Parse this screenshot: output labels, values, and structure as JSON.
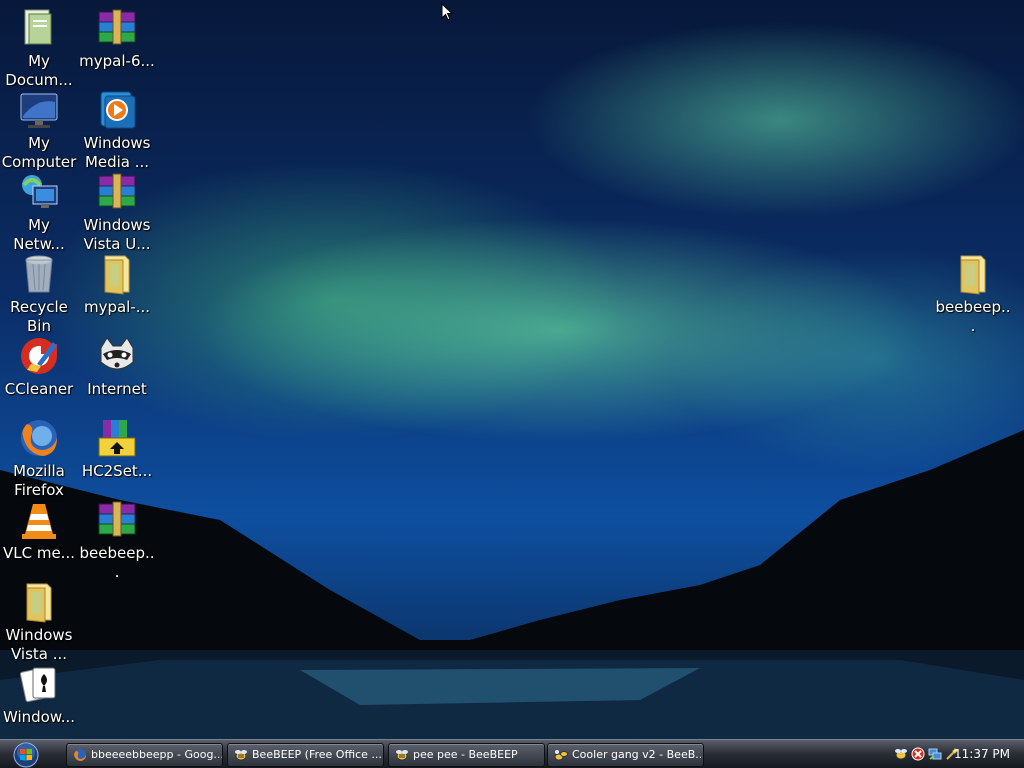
{
  "desktop": {
    "icons_left": [
      {
        "label": "My Docum...",
        "icon": "my-documents-icon"
      },
      {
        "label": "My Computer",
        "icon": "my-computer-icon"
      },
      {
        "label": "My Netw...",
        "icon": "my-network-icon"
      },
      {
        "label": "Recycle Bin",
        "icon": "recycle-bin-icon"
      },
      {
        "label": "CCleaner",
        "icon": "ccleaner-icon"
      },
      {
        "label": "Mozilla Firefox",
        "icon": "firefox-icon"
      },
      {
        "label": "VLC me...",
        "icon": "vlc-icon"
      },
      {
        "label": "Windows Vista ...",
        "icon": "folder-icon"
      },
      {
        "label": "Window...",
        "icon": "solitaire-icon"
      }
    ],
    "icons_col2": [
      {
        "label": "mypal-6...",
        "icon": "winrar-archive-icon"
      },
      {
        "label": "Windows Media ...",
        "icon": "windows-media-player-icon"
      },
      {
        "label": "Windows Vista U...",
        "icon": "winrar-archive-icon"
      },
      {
        "label": "mypal-...",
        "icon": "folder-icon"
      },
      {
        "label": "Internet",
        "icon": "raccoon-icon"
      },
      {
        "label": "HC2Set...",
        "icon": "winrar-installer-icon"
      },
      {
        "label": "beebeep...",
        "icon": "winrar-archive-icon"
      }
    ],
    "icons_right": [
      {
        "label": "beebeep...",
        "icon": "folder-icon"
      }
    ]
  },
  "taskbar": {
    "start_icon": "windows-start-orb-icon",
    "buttons": [
      {
        "label": "bbeeeebbeepp - Goog...",
        "icon": "firefox-icon"
      },
      {
        "label": "BeeBEEP (Free Office ...",
        "icon": "beebeep-icon"
      },
      {
        "label": "pee pee - BeeBEEP",
        "icon": "beebeep-icon"
      },
      {
        "label": "Cooler gang v2 - BeeB...",
        "icon": "beebeep-group-icon"
      }
    ],
    "tray": {
      "icons": [
        "beebeep-tray-icon",
        "security-tray-icon",
        "network-tray-icon",
        "wand-tray-icon"
      ],
      "clock": "11:37 PM"
    }
  },
  "colors": {
    "aurora": "#6fffa8",
    "sky": "#0e4fa0",
    "taskbar": "#2a2f38"
  }
}
